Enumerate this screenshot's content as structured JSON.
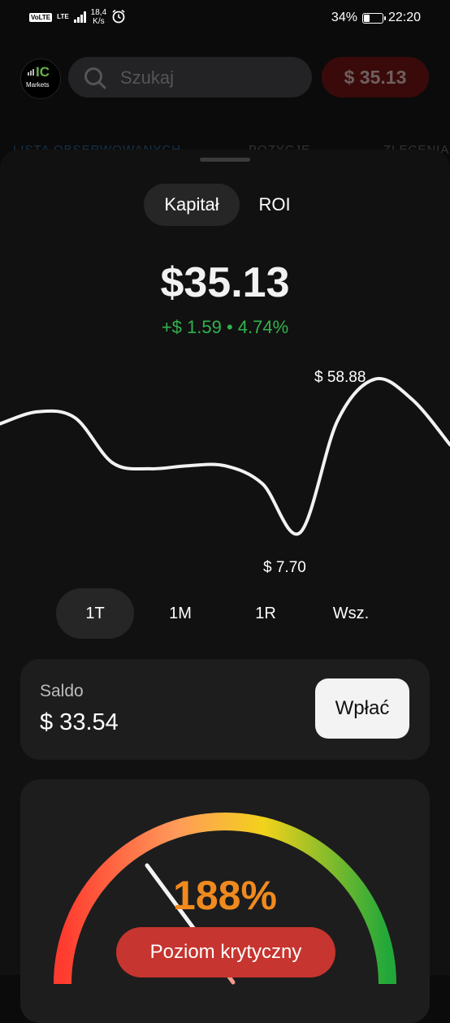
{
  "status_bar": {
    "volte": "VoLTE",
    "network": "LTE",
    "speed_value": "18,4",
    "speed_unit": "K/s",
    "battery_label": "34%",
    "battery_level": 0.34,
    "time": "22:20"
  },
  "top_bar": {
    "logo_text": "IC",
    "logo_subtext": "Markets",
    "search_placeholder": "Szukaj",
    "balance": "$ 35.13"
  },
  "background_tabs": [
    "LISTA OBSERWOWANYCH",
    "POZYCJE",
    "ZLECENIA"
  ],
  "sheet": {
    "toggle": [
      {
        "label": "Kapitał",
        "active": true
      },
      {
        "label": "ROI",
        "active": false
      }
    ],
    "equity_value": "$35.13",
    "equity_change": "+$ 1.59 • 4.74%",
    "chart_labels": {
      "max": "$ 58.88",
      "min": "$ 7.70"
    },
    "periods": [
      {
        "label": "1T",
        "active": true
      },
      {
        "label": "1M",
        "active": false
      },
      {
        "label": "1R",
        "active": false
      },
      {
        "label": "Wsz.",
        "active": false
      }
    ],
    "balance_card": {
      "label": "Saldo",
      "value": "$ 33.54",
      "deposit_button": "Wpłać"
    },
    "margin_card": {
      "percent": "188%",
      "status": "Poziom krytyczny",
      "level": 188
    }
  },
  "chart_data": {
    "type": "line",
    "x": [
      0,
      1,
      2,
      3,
      4,
      5,
      6,
      7,
      8,
      9,
      10,
      11,
      12
    ],
    "y": [
      44,
      48,
      46,
      31,
      29,
      30,
      30,
      24,
      7.7,
      45,
      58.88,
      52,
      37
    ],
    "max_label": "$ 58.88",
    "min_label": "$ 7.70",
    "ylim": [
      0,
      65
    ],
    "grid": false,
    "line_color": "#f2f2f2"
  },
  "colors": {
    "positive": "#33b14e",
    "critical": "#c6352f",
    "margin_value": "#f08a1e",
    "background": "#0b0b0b",
    "card": "#1d1d1d"
  }
}
